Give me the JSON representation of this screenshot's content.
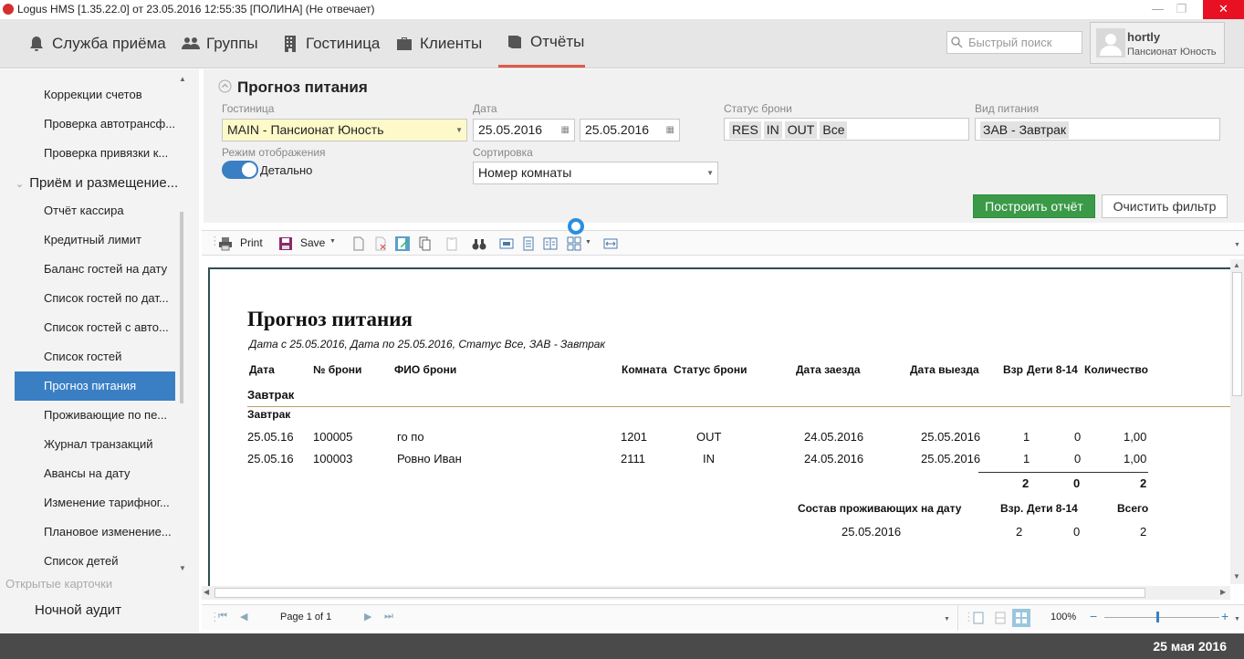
{
  "window": {
    "title": "Logus HMS [1.35.22.0] от 23.05.2016 12:55:35 [ПОЛИНА] (Не отвечает)",
    "minimize": "—",
    "restore": "❐",
    "close": "✕"
  },
  "nav": {
    "items": [
      {
        "label": "Служба приёма",
        "icon": "bell-icon"
      },
      {
        "label": "Группы",
        "icon": "people-icon"
      },
      {
        "label": "Гостиница",
        "icon": "building-icon"
      },
      {
        "label": "Клиенты",
        "icon": "briefcase-icon"
      },
      {
        "label": "Отчёты",
        "icon": "book-icon"
      }
    ],
    "active": "Отчёты"
  },
  "search": {
    "placeholder": "Быстрый поиск"
  },
  "user": {
    "name": "hortly",
    "hotel": "Пансионат Юность"
  },
  "sidebar": {
    "items_top": [
      "Коррекции счетов",
      "Проверка автотрансф...",
      "Проверка привязки к..."
    ],
    "group": "Приём и размещение...",
    "items": [
      "Отчёт кассира",
      "Кредитный лимит",
      "Баланс гостей на дату",
      "Список гостей по дат...",
      "Список гостей с авто...",
      "Список гостей",
      "Прогноз питания",
      "Проживающие по пе...",
      "Журнал транзакций",
      "Авансы на дату",
      "Изменение тарифног...",
      "Плановое изменение...",
      "Список детей"
    ],
    "selected": "Прогноз питания",
    "open_cards": "Открытые карточки",
    "night_audit": "Ночной аудит"
  },
  "filter": {
    "title": "Прогноз питания",
    "hotel_label": "Гостиница",
    "hotel_value": "MAIN - Пансионат Юность",
    "date_label": "Дата",
    "date_from": "25.05.2016",
    "date_to": "25.05.2016",
    "status_label": "Статус брони",
    "status_tags": [
      "RES",
      "IN",
      "OUT",
      "Все"
    ],
    "meal_label": "Вид питания",
    "meal_tag": "ЗАВ - Завтрак",
    "mode_label": "Режим отображения",
    "mode_value": "Детально",
    "sort_label": "Сортировка",
    "sort_value": "Номер комнаты",
    "build_button": "Построить отчёт",
    "clear_button": "Очистить фильтр"
  },
  "toolbar": {
    "print": "Print",
    "save": "Save"
  },
  "report": {
    "title": "Прогноз питания",
    "subtitle": "Дата с 25.05.2016, Дата по 25.05.2016, Статус Все, ЗАВ - Завтрак",
    "columns": [
      "Дата",
      "№ брони",
      "ФИО брони",
      "Комната",
      "Статус брони",
      "Дата заезда",
      "Дата выезда",
      "Взр",
      "Дети 8-14",
      "Количество"
    ],
    "group1": "Завтрак",
    "group2": "Завтрак",
    "rows": [
      [
        "25.05.16",
        "100005",
        "го по",
        "1201",
        "OUT",
        "24.05.2016",
        "25.05.2016",
        "1",
        "0",
        "1,00"
      ],
      [
        "25.05.16",
        "100003",
        "Ровно Иван",
        "2111",
        "IN",
        "24.05.2016",
        "25.05.2016",
        "1",
        "0",
        "1,00"
      ]
    ],
    "totals": [
      "2",
      "0",
      "2"
    ],
    "composition": {
      "label": "Состав проживающих на дату",
      "adult": "Взр.",
      "kids": "Дети 8-14",
      "total": "Всего",
      "date": "25.05.2016",
      "values": [
        "2",
        "0",
        "2"
      ]
    }
  },
  "statusbar": {
    "page": "Page 1 of 1",
    "zoom": "100%"
  },
  "footer": {
    "date": "25 мая 2016"
  },
  "colors": {
    "accent": "#3a7fc4",
    "build": "#3a9a48",
    "active_tab": "#e05a4b",
    "footer": "#4a4a4a"
  }
}
